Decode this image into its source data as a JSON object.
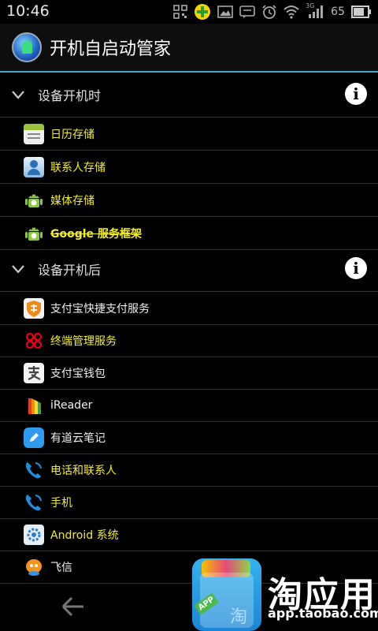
{
  "status_bar": {
    "time": "10:46",
    "signal_type": "3G",
    "battery": "65"
  },
  "title_bar": {
    "title": "开机自启动管家"
  },
  "sections": [
    {
      "header": "设备开机时",
      "items": [
        {
          "label": "日历存储",
          "icon": "calendar-icon",
          "color": "#f1ee2a"
        },
        {
          "label": "联系人存储",
          "icon": "contacts-icon",
          "color": "#f1ee2a"
        },
        {
          "label": "媒体存储",
          "icon": "android-icon",
          "color": "#f1ee2a"
        },
        {
          "label": "Google 服务框架",
          "icon": "android-icon",
          "color": "#f1ee2a",
          "strikethrough": true
        }
      ]
    },
    {
      "header": "设备开机后",
      "items": [
        {
          "label": "支付宝快捷支付服务",
          "icon": "alipay-shield-icon",
          "color": "#f0f0f0"
        },
        {
          "label": "终端管理服务",
          "icon": "china-unicom-icon",
          "color": "#f1ee2a"
        },
        {
          "label": "支付宝钱包",
          "icon": "alipay-wallet-icon",
          "color": "#f0f0f0"
        },
        {
          "label": "iReader",
          "icon": "ireader-icon",
          "color": "#f0f0f0"
        },
        {
          "label": "有道云笔记",
          "icon": "youdao-note-icon",
          "color": "#f0f0f0"
        },
        {
          "label": "电话和联系人",
          "icon": "phone-icon",
          "color": "#f1ee2a"
        },
        {
          "label": "手机",
          "icon": "phone-icon",
          "color": "#f1ee2a"
        },
        {
          "label": "Android 系统",
          "icon": "settings-icon",
          "color": "#f1ee2a"
        },
        {
          "label": "飞信",
          "icon": "fetion-icon",
          "color": "#f0f0f0"
        }
      ]
    }
  ],
  "nav_bar": {
    "back": "back-arrow-icon"
  },
  "watermark": {
    "logo_text": "淘应用",
    "url": "app.taobao.com",
    "badge": "APP",
    "bag_char": "淘"
  }
}
